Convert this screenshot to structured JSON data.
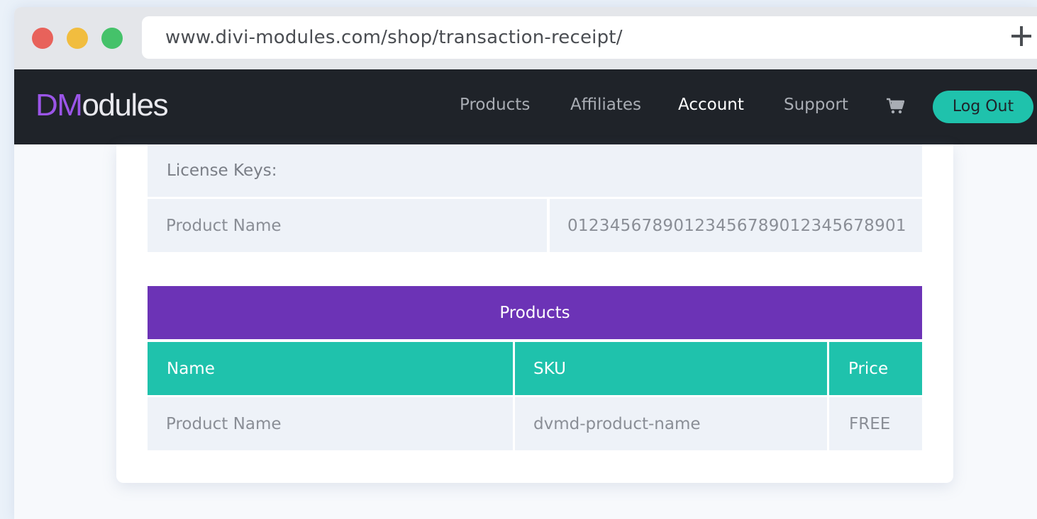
{
  "browser": {
    "url": "www.divi-modules.com/shop/transaction-receipt/",
    "new_tab_icon": "plus-icon"
  },
  "nav": {
    "logo_brand": "DM",
    "logo_rest": "odules",
    "items": [
      "Products",
      "Affiliates",
      "Account",
      "Support"
    ],
    "active_item": "Account",
    "cart_icon": "cart-icon",
    "logout_label": "Log Out"
  },
  "license": {
    "heading": "License Keys:",
    "rows": [
      {
        "product": "Product Name",
        "key": "01234567890123456789012345678901"
      }
    ]
  },
  "products": {
    "title": "Products",
    "columns": [
      "Name",
      "SKU",
      "Price"
    ],
    "rows": [
      {
        "name": "Product Name",
        "sku": "dvmd-product-name",
        "price": "FREE"
      }
    ]
  },
  "colors": {
    "accent_purple": "#6c33b6",
    "accent_teal": "#1fc2ac",
    "nav_bg": "#1f2329"
  }
}
